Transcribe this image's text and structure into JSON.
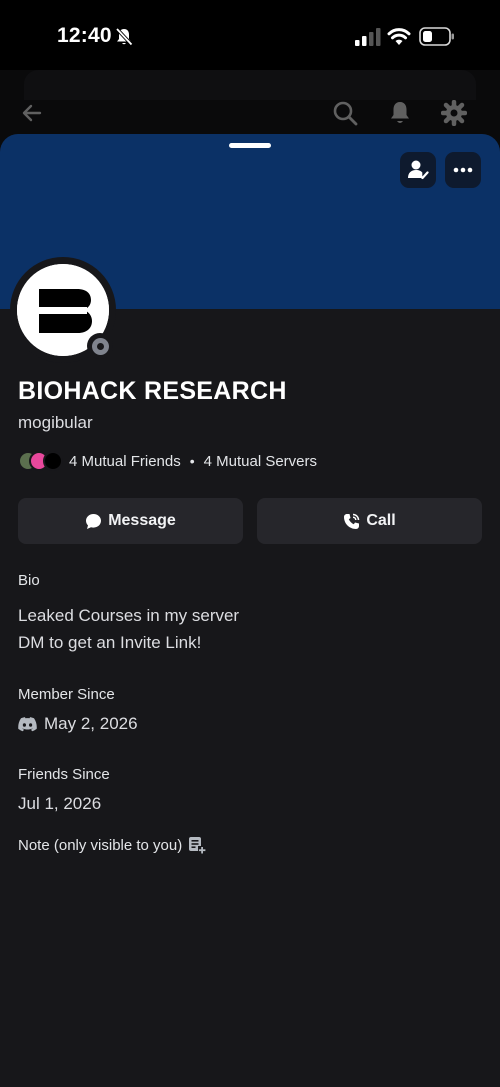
{
  "status_bar": {
    "time": "12:40"
  },
  "profile": {
    "display_name": "BIOHACK RESEARCH",
    "username": "mogibular",
    "mutual_friends": "4 Mutual Friends",
    "mutual_servers": "4 Mutual Servers",
    "separator": "•"
  },
  "actions": {
    "message_label": "Message",
    "call_label": "Call"
  },
  "bio": {
    "label": "Bio",
    "lines": [
      "Leaked Courses in my server",
      "DM to get an Invite Link!"
    ]
  },
  "member_since": {
    "label": "Member Since",
    "date": "May 2, 2026"
  },
  "friends_since": {
    "label": "Friends Since",
    "date": "Jul 1, 2026"
  },
  "note": {
    "label": "Note (only visible to you)"
  },
  "colors": {
    "banner": "#0b3166",
    "sheet": "#17171a",
    "button": "#26262b"
  },
  "icons": [
    "mute-bell-icon",
    "signal-icon",
    "wifi-icon",
    "battery-icon",
    "back-arrow-icon",
    "search-icon",
    "bell-icon",
    "gear-icon",
    "friend-check-icon",
    "more-icon",
    "chat-bubble-icon",
    "phone-icon",
    "discord-icon",
    "note-add-icon"
  ]
}
